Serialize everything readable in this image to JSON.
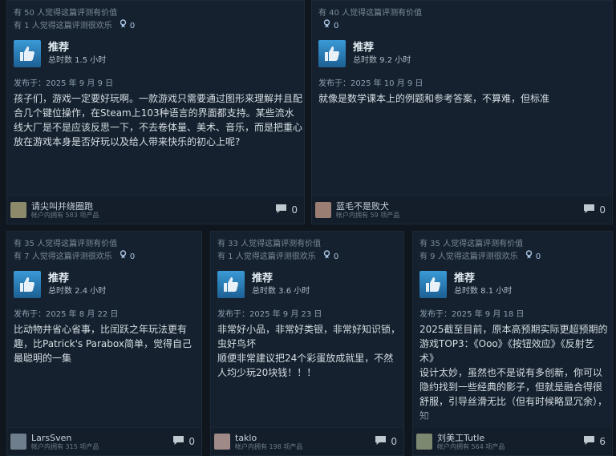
{
  "reviews": [
    {
      "helpful": "有 50 人觉得这篇评测有价值",
      "funny": "有 1 人觉得这篇评测很欢乐",
      "awards": "0",
      "recommend": "推荐",
      "hours": "总时数 1.5 小时",
      "date": "发布于：2025 年 9 月 9 日",
      "text": "孩子们，游戏一定要好玩啊。一款游戏只需要通过图形来理解并且配合几个键位操作，在Steam上103种语言的界面都支持。某些流水线大厂是不是应该反思一下，不去卷体量、美术、音乐，而是把重心放在游戏本身是否好玩以及给人带来快乐的初心上呢?",
      "user": "请尖叫并绕圈跑",
      "products": "帐户内拥有 583 项产品",
      "comments": "0"
    },
    {
      "helpful": "有 40 人觉得这篇评测有价值",
      "funny": "",
      "awards": "0",
      "recommend": "推荐",
      "hours": "总时数 9.2 小时",
      "date": "发布于：2025 年 10 月 9 日",
      "text": "就像是数学课本上的例题和参考答案，不算难，但标准",
      "user": "蓝毛不是败犬",
      "products": "帐户内拥有 59 项产品",
      "comments": "0"
    },
    {
      "helpful": "有 35 人觉得这篇评测有价值",
      "funny": "有 7 人觉得这篇评测很欢乐",
      "awards": "0",
      "recommend": "推荐",
      "hours": "总时数 2.4 小时",
      "date": "发布于：2025 年 8 月 22 日",
      "text": "比动物井省心省事，比闰跃之年玩法更有趣，比Patrick's Parabox简单，觉得自己最聪明的一集",
      "user": "LarsSven",
      "products": "帐户内拥有 315 项产品",
      "comments": "0"
    },
    {
      "helpful": "有 33 人觉得这篇评测有价值",
      "funny": "有 1 人觉得这篇评测很欢乐",
      "awards": "0",
      "recommend": "推荐",
      "hours": "总时数 3.6 小时",
      "date": "发布于：2025 年 9 月 23 日",
      "text": "非常好小品，非常好类银，非常好知识锁，虫好鸟坏\n顺便非常建议把24个彩蛋放成就里，不然人均少玩20块钱！！！",
      "user": "taklo",
      "products": "帐户内拥有 198 项产品",
      "comments": "0"
    },
    {
      "helpful": "有 35 人觉得这篇评测有价值",
      "funny": "有 9 人觉得这篇评测很欢乐",
      "awards": "0",
      "recommend": "推荐",
      "hours": "总时数 8.1 小时",
      "date": "发布于：2025 年 9 月 18 日",
      "text": "2025截至目前，原本高预期实际更超预期的游戏TOP3：《Ooo》《按钮效应》《反射艺术》\n设计太妙，虽然也不是说有多创新，你可以隐约找到一些经典的影子，但就是融合得很舒服，引导丝滑无比（但有时候略显冗余），知",
      "user": "刘美工Tutle",
      "products": "帐户内拥有 564 项产品",
      "comments": "6"
    }
  ]
}
